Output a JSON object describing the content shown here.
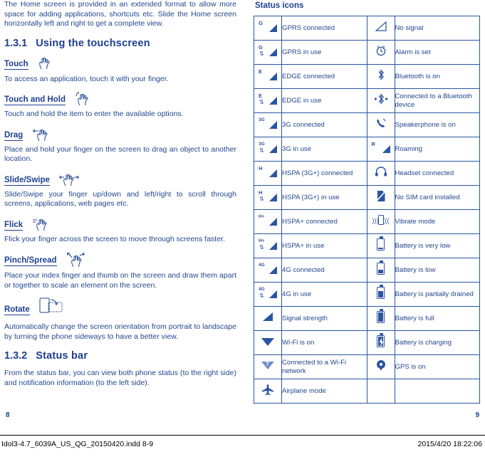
{
  "left": {
    "intro": "The Home screen is provided in an extended format to allow more space for adding applications, shortcuts etc. Slide the Home screen horizontally left and right to get a complete view.",
    "section1": {
      "number": "1.3.1",
      "title": "Using the touchscreen"
    },
    "gestures": [
      {
        "name": "Touch",
        "icon": "touch-hand-icon",
        "text": "To access an application, touch it with your finger."
      },
      {
        "name": "Touch and Hold",
        "icon": "touch-hold-hand-icon",
        "text": "Touch and hold the item to enter the available options."
      },
      {
        "name": "Drag",
        "icon": "drag-hand-icon",
        "text": "Place and hold your finger on the screen to drag an object to another location."
      },
      {
        "name": "Slide/Swipe",
        "icon": "swipe-hand-icon",
        "text": "Slide/Swipe your finger up/down and left/right to scroll through screens, applications, web pages etc."
      },
      {
        "name": "Flick",
        "icon": "flick-hand-icon",
        "text": "Flick your finger across the screen to move through screens faster."
      },
      {
        "name": "Pinch/Spread",
        "icon": "pinch-spread-hand-icon",
        "text": "Place your index finger and thumb on the screen and draw them apart or together to scale an element on the screen."
      },
      {
        "name": "Rotate",
        "icon": "rotate-screen-icon",
        "text": "Automatically change the screen orientation from portrait to landscape by turning the phone sideways to have a better view."
      }
    ],
    "section2": {
      "number": "1.3.2",
      "title": "Status bar"
    },
    "statusbar_text": "From the status bar, you can view both phone status (to the right side) and notification information (to the left side)."
  },
  "right": {
    "title": "Status icons",
    "rows": [
      {
        "icon1": "gprs-connected-icon",
        "label1": "GPRS connected",
        "icon2": "no-signal-icon",
        "label2": "No signal"
      },
      {
        "icon1": "gprs-in-use-icon",
        "label1": "GPRS in use",
        "icon2": "alarm-icon",
        "label2": "Alarm is set"
      },
      {
        "icon1": "edge-connected-icon",
        "label1": "EDGE connected",
        "icon2": "bluetooth-on-icon",
        "label2": "Bluetooth is on"
      },
      {
        "icon1": "edge-in-use-icon",
        "label1": "EDGE in use",
        "icon2": "bluetooth-connected-icon",
        "label2": "Connected to a Bluetooth device"
      },
      {
        "icon1": "3g-connected-icon",
        "label1": "3G connected",
        "icon2": "speakerphone-icon",
        "label2": "Speakerphone is on"
      },
      {
        "icon1": "3g-in-use-icon",
        "label1": "3G in use",
        "icon2": "roaming-icon",
        "label2": "Roaming"
      },
      {
        "icon1": "hspa-connected-icon",
        "label1": "HSPA (3G+) connected",
        "icon2": "headset-icon",
        "label2": "Headset connected"
      },
      {
        "icon1": "hspa-in-use-icon",
        "label1": "HSPA (3G+) in use",
        "icon2": "no-sim-icon",
        "label2": "No SIM card installed"
      },
      {
        "icon1": "hspa-plus-connected-icon",
        "label1": "HSPA+ connected",
        "icon2": "vibrate-icon",
        "label2": "Vibrate mode"
      },
      {
        "icon1": "hspa-plus-in-use-icon",
        "label1": "HSPA+ in use",
        "icon2": "battery-very-low-icon",
        "label2": "Battery is very low"
      },
      {
        "icon1": "4g-connected-icon",
        "label1": "4G connected",
        "icon2": "battery-low-icon",
        "label2": "Battery is low"
      },
      {
        "icon1": "4g-in-use-icon",
        "label1": "4G in use",
        "icon2": "battery-partial-icon",
        "label2": "Battery is partially drained"
      },
      {
        "icon1": "signal-strength-icon",
        "label1": "Signal strength",
        "icon2": "battery-full-icon",
        "label2": "Battery is full"
      },
      {
        "icon1": "wifi-on-icon",
        "label1": "Wi-Fi is on",
        "icon2": "battery-charging-icon",
        "label2": "Battery is charging"
      },
      {
        "icon1": "wifi-connected-icon",
        "label1": "Connected to a Wi-Fi network",
        "icon2": "gps-icon",
        "label2": "GPS is on"
      },
      {
        "icon1": "airplane-mode-icon",
        "label1": "Airplane mode",
        "icon2": "",
        "label2": ""
      }
    ]
  },
  "footer": {
    "page_left": "8",
    "page_right": "9",
    "file": "Idol3-4.7_6039A_US_QG_20150420.indd   8-9",
    "timestamp": "2015/4/20   18:22:06"
  }
}
